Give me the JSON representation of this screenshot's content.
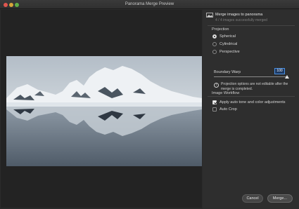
{
  "window": {
    "title": "Panorama Merge Preview"
  },
  "header": {
    "title": "Merge images to panorama",
    "subtitle": "4 / 4 images successfully merged"
  },
  "projection": {
    "label": "Projection",
    "options": [
      {
        "label": "Spherical",
        "selected": true
      },
      {
        "label": "Cylindrical",
        "selected": false
      },
      {
        "label": "Perspective",
        "selected": false
      }
    ]
  },
  "boundary_warp": {
    "label": "Boundary Warp",
    "value": "100",
    "level_percent": 100
  },
  "info": {
    "icon": "info-icon",
    "text": "Projection options are not editable after the merge is completed."
  },
  "workflow": {
    "label": "Image Workflow",
    "options": [
      {
        "label": "Apply auto tone and color adjustments",
        "checked": true
      },
      {
        "label": "Auto Crop",
        "checked": false
      }
    ]
  },
  "buttons": {
    "cancel": "Cancel",
    "merge": "Merge..."
  },
  "colors": {
    "accent": "#4a8fe0",
    "panel": "#2e2e2e",
    "preview_bg": "#232323"
  }
}
